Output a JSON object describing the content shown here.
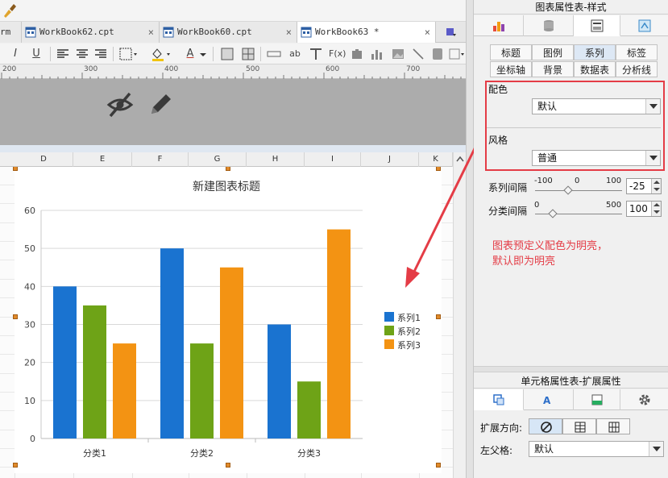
{
  "tabs": [
    {
      "label": "rm",
      "active": false
    },
    {
      "label": "WorkBook62.cpt",
      "active": false
    },
    {
      "label": "WorkBook60.cpt",
      "active": false
    },
    {
      "label": "WorkBook63 *",
      "active": true
    }
  ],
  "tab_close_glyph": "×",
  "toolbar": {
    "italic": "I",
    "underline": "U",
    "text_a": "A",
    "ab": "ab",
    "fx": "F(x)"
  },
  "ruler": [
    "200",
    "300",
    "400",
    "500",
    "600",
    "700"
  ],
  "columns": [
    "D",
    "E",
    "F",
    "G",
    "H",
    "I",
    "J",
    "K"
  ],
  "chart_data": {
    "type": "bar",
    "title": "新建图表标题",
    "categories": [
      "分类1",
      "分类2",
      "分类3"
    ],
    "series": [
      {
        "name": "系列1",
        "values": [
          40,
          50,
          30
        ],
        "color": "#1a73d0"
      },
      {
        "name": "系列2",
        "values": [
          35,
          25,
          15
        ],
        "color": "#6ea317"
      },
      {
        "name": "系列3",
        "values": [
          25,
          45,
          55
        ],
        "color": "#f39313"
      }
    ],
    "ylim": [
      0,
      60
    ],
    "yticks": [
      0,
      10,
      20,
      30,
      40,
      50,
      60
    ],
    "grid": true,
    "legend": "right"
  },
  "panel": {
    "title": "图表属性表-样式",
    "subtabs_row1": [
      "标题",
      "图例",
      "系列",
      "标签"
    ],
    "subtabs_row2": [
      "坐标轴",
      "背景",
      "数据表",
      "分析线"
    ],
    "active_subtab": "系列",
    "color_label": "配色",
    "color_value": "默认",
    "style_label": "风格",
    "style_value": "普通",
    "series_gap": {
      "label": "系列间隔",
      "min": "-100",
      "mid": "0",
      "max": "100",
      "value": "-25",
      "fraction": 0.375
    },
    "category_gap": {
      "label": "分类间隔",
      "min": "0",
      "max": "500",
      "value": "100",
      "fraction": 0.2
    },
    "note": "图表预定义配色为明亮，\n默认即为明亮"
  },
  "cell_panel": {
    "title": "单元格属性表-扩展属性",
    "expand_label": "扩展方向:",
    "parent_label": "左父格:",
    "parent_value": "默认"
  },
  "colors": {
    "accent_red": "#e43c46",
    "series1": "#1a73d0",
    "series2": "#6ea317",
    "series3": "#f39313"
  }
}
